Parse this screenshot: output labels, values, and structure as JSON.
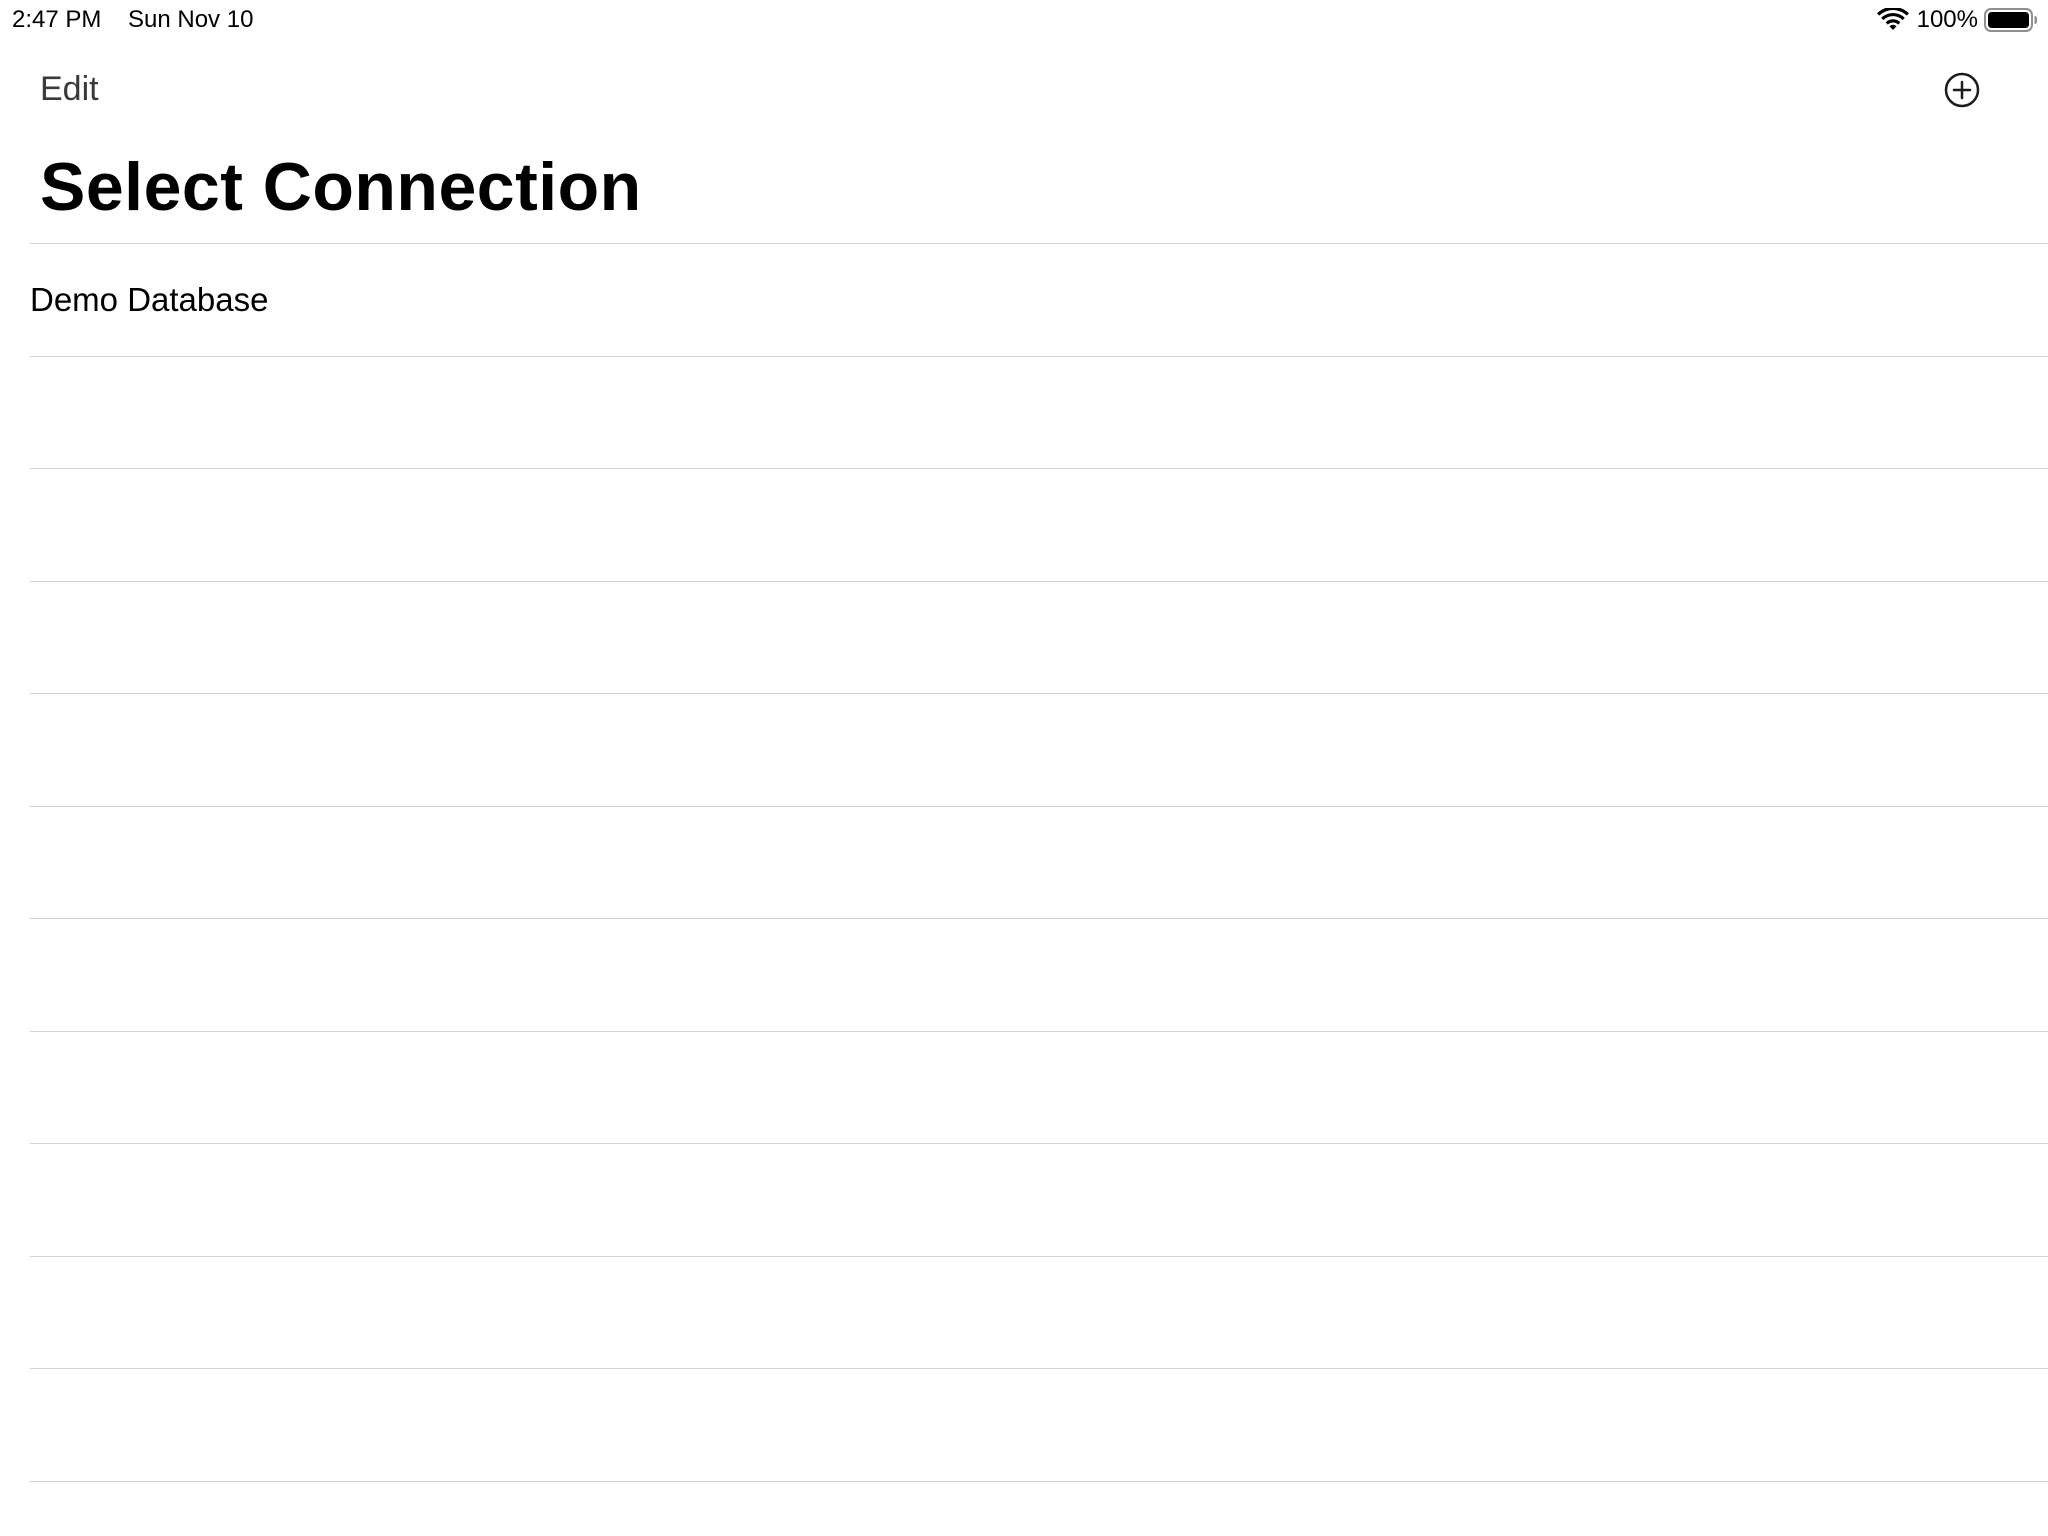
{
  "status_bar": {
    "time": "2:47 PM",
    "date": "Sun Nov 10",
    "battery_percent": "100%",
    "icons": [
      "wifi-icon",
      "battery-icon"
    ]
  },
  "nav": {
    "edit_label": "Edit",
    "add_icon": "plus-circle-icon"
  },
  "title": "Select Connection",
  "connections": [
    {
      "label": "Demo Database"
    },
    {
      "label": ""
    },
    {
      "label": ""
    },
    {
      "label": ""
    },
    {
      "label": ""
    },
    {
      "label": ""
    },
    {
      "label": ""
    },
    {
      "label": ""
    },
    {
      "label": ""
    },
    {
      "label": ""
    },
    {
      "label": ""
    }
  ],
  "colors": {
    "separator": "#d1d1d6",
    "nav_text": "#3a3a3c"
  }
}
